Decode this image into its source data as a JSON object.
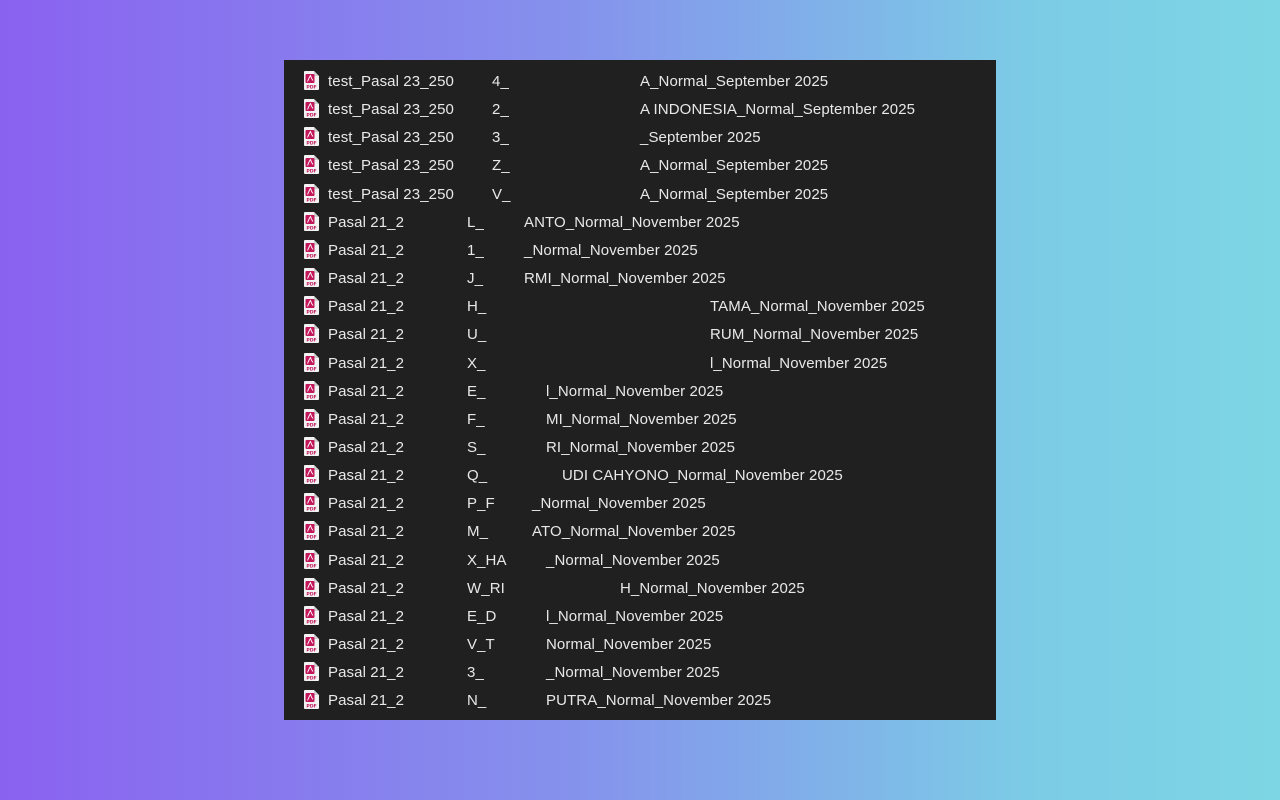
{
  "files": [
    {
      "icon": "pdf-file-icon",
      "prefix": "test_Pasal 23_250",
      "mid": "4_",
      "suffix": "A_Normal_September 2025"
    },
    {
      "icon": "pdf-file-icon",
      "prefix": "test_Pasal 23_250",
      "mid": "2_",
      "suffix": "A INDONESIA_Normal_September 2025"
    },
    {
      "icon": "pdf-file-icon",
      "prefix": "test_Pasal 23_250",
      "mid": "3_",
      "suffix": "_September 2025"
    },
    {
      "icon": "pdf-file-icon",
      "prefix": "test_Pasal 23_250",
      "mid": "Z_",
      "suffix": "A_Normal_September 2025"
    },
    {
      "icon": "pdf-file-icon",
      "prefix": "test_Pasal 23_250",
      "mid": "V_",
      "suffix": "A_Normal_September 2025"
    },
    {
      "icon": "pdf-file-icon",
      "prefix": "Pasal 21_2",
      "mid": "L_",
      "suffix": "ANTO_Normal_November 2025"
    },
    {
      "icon": "pdf-file-icon",
      "prefix": "Pasal 21_2",
      "mid": "1_",
      "suffix": "_Normal_November 2025"
    },
    {
      "icon": "pdf-file-icon",
      "prefix": "Pasal 21_2",
      "mid": "J_",
      "suffix": "RMI_Normal_November 2025"
    },
    {
      "icon": "pdf-file-icon",
      "prefix": "Pasal 21_2",
      "mid": "H_",
      "suffix": "TAMA_Normal_November 2025"
    },
    {
      "icon": "pdf-file-icon",
      "prefix": "Pasal 21_2",
      "mid": "U_",
      "suffix": "RUM_Normal_November 2025"
    },
    {
      "icon": "pdf-file-icon",
      "prefix": "Pasal 21_2",
      "mid": "X_",
      "suffix": "l_Normal_November 2025"
    },
    {
      "icon": "pdf-file-icon",
      "prefix": "Pasal 21_2",
      "mid": "E_",
      "suffix": "l_Normal_November 2025"
    },
    {
      "icon": "pdf-file-icon",
      "prefix": "Pasal 21_2",
      "mid": "F_",
      "suffix": "MI_Normal_November 2025"
    },
    {
      "icon": "pdf-file-icon",
      "prefix": "Pasal 21_2",
      "mid": "S_",
      "suffix": "RI_Normal_November 2025"
    },
    {
      "icon": "pdf-file-icon",
      "prefix": "Pasal 21_2",
      "mid": "Q_",
      "suffix": "UDI CAHYONO_Normal_November 2025"
    },
    {
      "icon": "pdf-file-icon",
      "prefix": "Pasal 21_2",
      "mid": "P_F",
      "suffix": "_Normal_November 2025"
    },
    {
      "icon": "pdf-file-icon",
      "prefix": "Pasal 21_2",
      "mid": "M_",
      "suffix": "ATO_Normal_November 2025"
    },
    {
      "icon": "pdf-file-icon",
      "prefix": "Pasal 21_2",
      "mid": "X_HA",
      "suffix": "_Normal_November 2025"
    },
    {
      "icon": "pdf-file-icon",
      "prefix": "Pasal 21_2",
      "mid": "W_RI",
      "suffix": "H_Normal_November 2025"
    },
    {
      "icon": "pdf-file-icon",
      "prefix": "Pasal 21_2",
      "mid": "E_D",
      "suffix": "l_Normal_November 2025"
    },
    {
      "icon": "pdf-file-icon",
      "prefix": "Pasal 21_2",
      "mid": "V_T",
      "suffix": "Normal_November 2025"
    },
    {
      "icon": "pdf-file-icon",
      "prefix": "Pasal 21_2",
      "mid": "3_",
      "suffix": "_Normal_November 2025"
    },
    {
      "icon": "pdf-file-icon",
      "prefix": "Pasal 21_2",
      "mid": "N_",
      "suffix": "PUTRA_Normal_November 2025"
    }
  ],
  "colors": {
    "background_gradient_start": "#8a62f0",
    "background_gradient_end": "#7dd6e4",
    "panel": "#202020",
    "text": "#e8e8e8",
    "pdf_icon": "#c2185b"
  }
}
